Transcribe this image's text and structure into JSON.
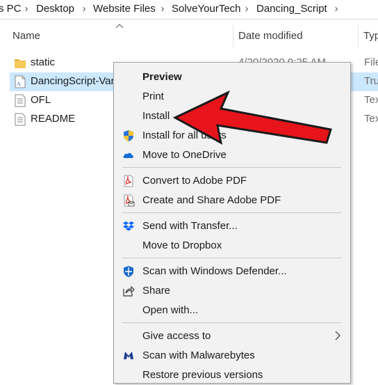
{
  "breadcrumb": {
    "items": [
      "s PC",
      "Desktop",
      "Website Files",
      "SolveYourTech",
      "Dancing_Script"
    ],
    "separator": "›"
  },
  "columns": {
    "name": "Name",
    "date_modified": "Date modified",
    "type": "Typ"
  },
  "files": [
    {
      "name": "static",
      "date": "4/20/2020 9:25 AM",
      "type": "File",
      "icon": "folder-icon"
    },
    {
      "name": "DancingScript-Var",
      "date": "",
      "type": "Tru",
      "icon": "font-file-icon",
      "selected": true
    },
    {
      "name": "OFL",
      "date": "",
      "type": "Tex",
      "icon": "text-file-icon"
    },
    {
      "name": "README",
      "date": "",
      "type": "Tex",
      "icon": "text-file-icon"
    }
  ],
  "context_menu": {
    "items": [
      {
        "label": "Preview",
        "bold": true,
        "icon": ""
      },
      {
        "label": "Print",
        "icon": ""
      },
      {
        "label": "Install",
        "icon": ""
      },
      {
        "label": "Install for all users",
        "icon": "uac-shield-icon"
      },
      {
        "label": "Move to OneDrive",
        "icon": "onedrive-icon"
      },
      {
        "label": "Convert to Adobe PDF",
        "icon": "adobe-pdf-icon"
      },
      {
        "label": "Create and Share Adobe PDF",
        "icon": "adobe-pdf-share-icon"
      },
      {
        "label": "Send with Transfer...",
        "icon": "dropbox-icon"
      },
      {
        "label": "Move to Dropbox",
        "icon": ""
      },
      {
        "label": "Scan with Windows Defender...",
        "icon": "windows-defender-icon"
      },
      {
        "label": "Share",
        "icon": "share-icon"
      },
      {
        "label": "Open with...",
        "icon": ""
      },
      {
        "label": "Give access to",
        "icon": "",
        "submenu": true
      },
      {
        "label": "Scan with Malwarebytes",
        "icon": "malwarebytes-icon"
      },
      {
        "label": "Restore previous versions",
        "icon": ""
      }
    ]
  },
  "colors": {
    "selection": "#cce8ff",
    "menu_bg": "#f2f2f2",
    "arrow": "#e8141b",
    "folder": "#e8b84a"
  }
}
